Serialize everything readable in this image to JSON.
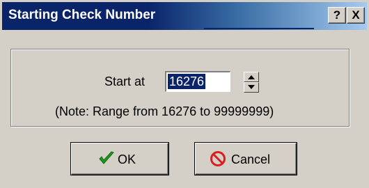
{
  "window": {
    "title": "Starting Check Number",
    "help_label": "?",
    "close_label": "X"
  },
  "form": {
    "start_label": "Start at",
    "start_value": "16276",
    "note": "(Note: Range from 16276 to 99999999)"
  },
  "buttons": {
    "ok_label": "OK",
    "cancel_label": "Cancel"
  },
  "icons": {
    "ok": "checkmark-icon",
    "cancel": "prohibited-icon",
    "spin_up": "arrow-up-icon",
    "spin_down": "arrow-down-icon"
  },
  "colors": {
    "titlebar": "#0a246a",
    "selection": "#0a246a",
    "ok_icon": "#1f9a1f",
    "cancel_icon": "#d81e1e"
  }
}
